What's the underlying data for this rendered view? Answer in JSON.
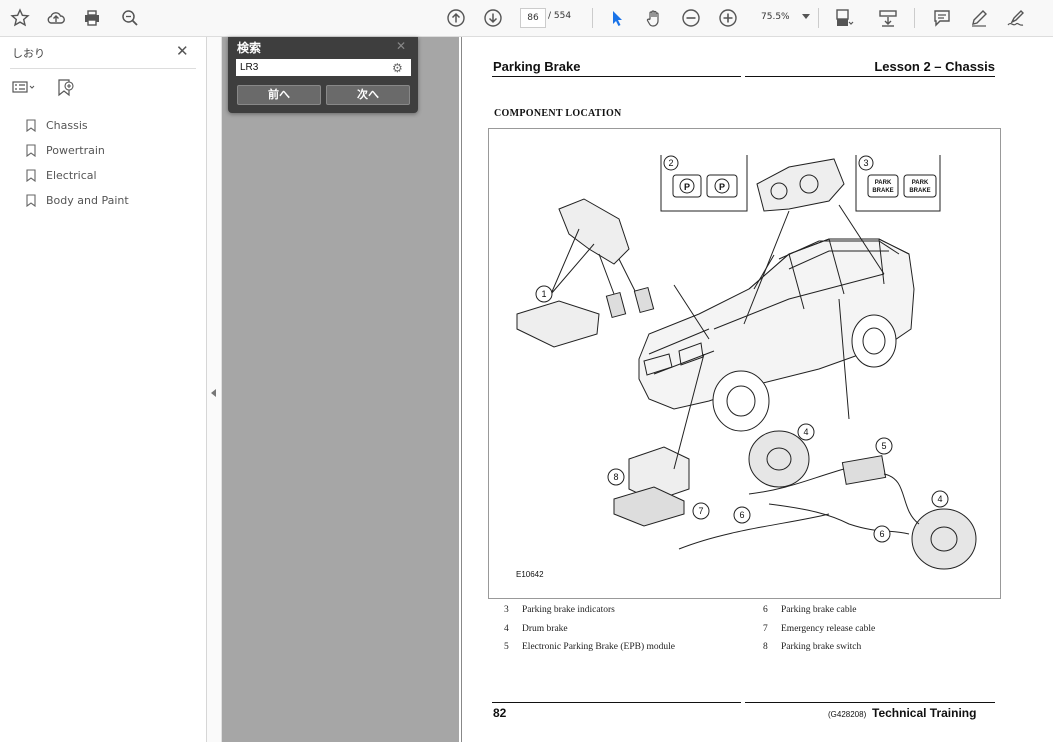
{
  "toolbar": {
    "current_page": "86",
    "page_separator": "/",
    "page_total": "554",
    "zoom": "75.5%"
  },
  "sidebar": {
    "title": "しおり",
    "bookmarks": [
      {
        "label": "Chassis"
      },
      {
        "label": "Powertrain"
      },
      {
        "label": "Electrical"
      },
      {
        "label": "Body and Paint"
      }
    ]
  },
  "search": {
    "title": "検索",
    "query": "LR3",
    "prev_label": "前へ",
    "next_label": "次へ"
  },
  "page": {
    "header_left": "Parking Brake",
    "header_right": "Lesson 2 – Chassis",
    "section_title": "COMPONENT LOCATION",
    "figure_code": "E10642",
    "callouts": [
      "1",
      "2",
      "3",
      "4",
      "4",
      "5",
      "6",
      "6",
      "7",
      "8"
    ],
    "legend": [
      {
        "num": "3",
        "text": "Parking brake indicators"
      },
      {
        "num": "4",
        "text": "Drum brake"
      },
      {
        "num": "5",
        "text": "Electronic Parking Brake (EPB) module"
      },
      {
        "num": "6",
        "text": "Parking brake cable"
      },
      {
        "num": "7",
        "text": "Emergency release cable"
      },
      {
        "num": "8",
        "text": "Parking brake switch"
      }
    ],
    "footer_page": "82",
    "footer_code": "(G428208)",
    "footer_right": "Technical Training",
    "indicator_labels": {
      "park": "PARK",
      "brake": "BRAKE",
      "p": "P"
    }
  },
  "colors": {
    "toolbar_bg": "#f8f8f8",
    "viewer_gray": "#a6a6a6",
    "search_panel": "#3e3e3e",
    "cursor_blue": "#1a73e8"
  }
}
